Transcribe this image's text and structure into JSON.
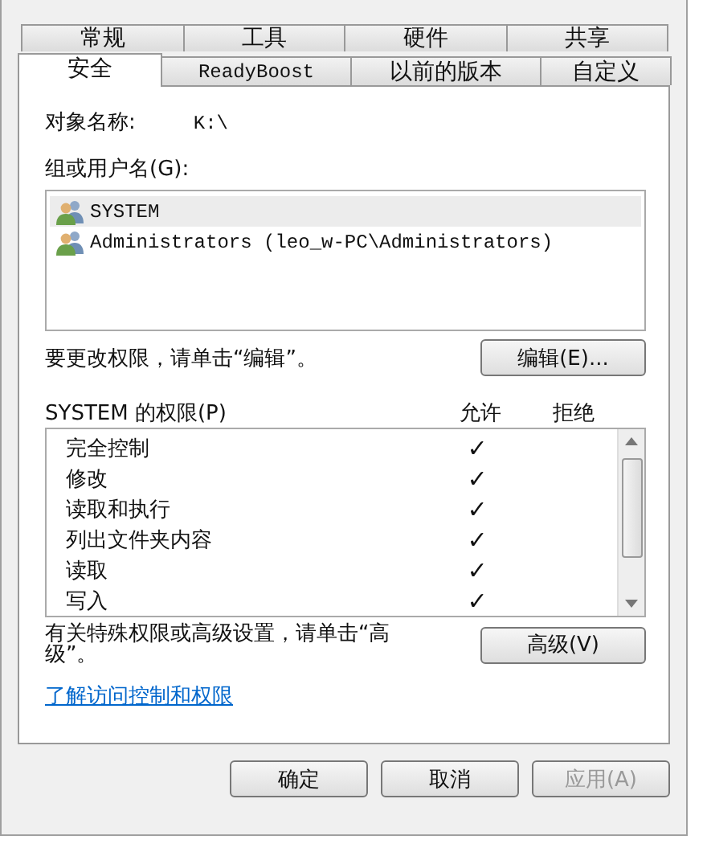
{
  "tabs_back": [
    {
      "label": "常规",
      "selected": false
    },
    {
      "label": "工具",
      "selected": false
    },
    {
      "label": "硬件",
      "selected": false
    },
    {
      "label": "共享",
      "selected": false
    }
  ],
  "tabs_front": [
    {
      "label": "安全",
      "selected": true
    },
    {
      "label": "ReadyBoost",
      "selected": false
    },
    {
      "label": "以前的版本",
      "selected": false
    },
    {
      "label": "自定义",
      "selected": false
    }
  ],
  "object_label": "对象名称:",
  "object_value": "K:\\",
  "users_label": "组或用户名(G):",
  "users": [
    {
      "name": "SYSTEM",
      "selected": true
    },
    {
      "name": "Administrators (leo_w-PC\\Administrators)",
      "selected": false
    }
  ],
  "edit_hint": "要更改权限，请单击“编辑”。",
  "edit_button": "编辑(E)...",
  "perm_title": "SYSTEM 的权限(P)",
  "allow_header": "允许",
  "deny_header": "拒绝",
  "permissions": [
    {
      "name": "完全控制",
      "allow": true,
      "deny": false
    },
    {
      "name": "修改",
      "allow": true,
      "deny": false
    },
    {
      "name": "读取和执行",
      "allow": true,
      "deny": false
    },
    {
      "name": "列出文件夹内容",
      "allow": true,
      "deny": false
    },
    {
      "name": "读取",
      "allow": true,
      "deny": false
    },
    {
      "name": "写入",
      "allow": true,
      "deny": false
    }
  ],
  "check_mark": "✓",
  "advanced_hint": "有关特殊权限或高级设置，请单击“高级”。",
  "advanced_button": "高级(V)",
  "link": "了解访问控制和权限",
  "buttons": [
    {
      "label": "确定",
      "disabled": false
    },
    {
      "label": "取消",
      "disabled": false
    },
    {
      "label": "应用(A)",
      "disabled": true
    }
  ]
}
